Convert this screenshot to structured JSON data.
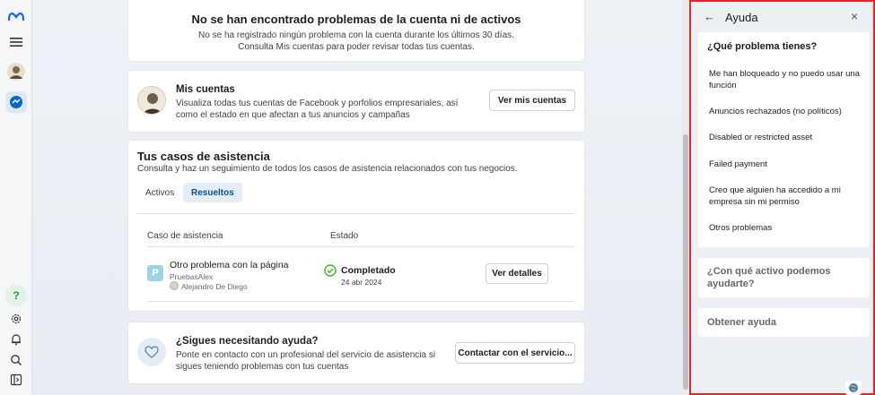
{
  "summary_card": {
    "title": "No se han encontrado problemas de la cuenta ni de activos",
    "line1": "No se ha registrado ningún problema con la cuenta durante los últimos 30 días.",
    "line2": "Consulta Mis cuentas para poder revisar todas tus cuentas."
  },
  "accounts_card": {
    "title": "Mis cuentas",
    "description": "Visualiza todas tus cuentas de Facebook y porfolios empresariales, así como el estado en que afectan a tus anuncios y campañas",
    "button": "Ver mis cuentas"
  },
  "cases_card": {
    "title": "Tus casos de asistencia",
    "description": "Consulta y haz un seguimiento de todos los casos de asistencia relacionados con tus negocios.",
    "tabs": [
      "Activos",
      "Resueltos"
    ],
    "columns": [
      "Caso de asistencia",
      "Estado"
    ],
    "row": {
      "icon_letter": "P",
      "name": "Otro problema con la página",
      "page": "PruebasAlex",
      "user": "Alejandro De Diego",
      "status": "Completado",
      "date": "24 abr 2024",
      "button": "Ver detalles"
    }
  },
  "help_card": {
    "title": "¿Sigues necesitando ayuda?",
    "description": "Ponte en contacto con un profesional del servicio de asistencia si sigues teniendo problemas con tus cuentas",
    "button": "Contactar con el servicio..."
  },
  "help_panel": {
    "title": "Ayuda",
    "section1_title": "¿Qué problema tienes?",
    "items": [
      "Me han bloqueado y no puedo usar una función",
      "Anuncios rechazados (no políticos)",
      "Disabled or restricted asset",
      "Failed payment",
      "Creo que alguien ha accedido a mi empresa sin mi permiso",
      "Otros problemas"
    ],
    "section2_title": "¿Con qué activo podemos ayudarte?",
    "section3_title": "Obtener ayuda"
  },
  "colors": {
    "accent": "#0a4f91",
    "selected_tab_bg": "#e3ecf7",
    "success": "#42b72a",
    "panel_border": "#e02828"
  },
  "icons": [
    "meta-logo-icon",
    "menu-icon",
    "profile-avatar",
    "ads-dashboard-icon",
    "help-icon",
    "settings-icon",
    "bell-icon",
    "search-icon",
    "sidebar-toggle-icon",
    "check-circle-icon",
    "heart-icon",
    "back-arrow-icon",
    "close-icon",
    "globe-icon"
  ]
}
